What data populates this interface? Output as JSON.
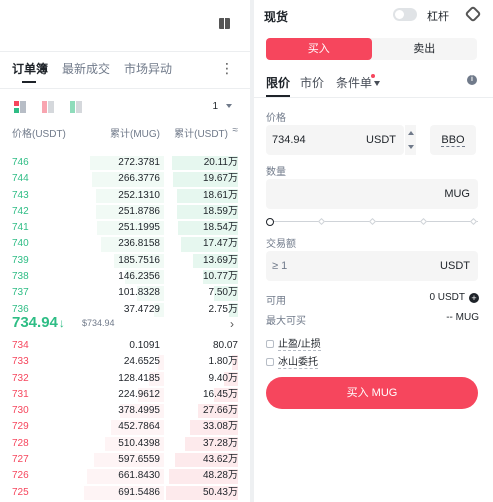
{
  "orderbook": {
    "tabs": [
      "订单簿",
      "最新成交",
      "市场异动"
    ],
    "more_icon": "more-vertical-icon",
    "depth_precision": "1",
    "headers": {
      "price": "价格(USDT)",
      "amount": "累计(MUG)",
      "total": "累计(USDT)",
      "toggle_icon": "≈"
    },
    "bids": [
      {
        "price": "746",
        "qty": "272.3781",
        "cum": "20.11万",
        "depth": 0.92
      },
      {
        "price": "744",
        "qty": "266.3776",
        "cum": "19.67万",
        "depth": 0.9
      },
      {
        "price": "743",
        "qty": "252.1310",
        "cum": "18.61万",
        "depth": 0.85
      },
      {
        "price": "742",
        "qty": "251.8786",
        "cum": "18.59万",
        "depth": 0.85
      },
      {
        "price": "741",
        "qty": "251.1995",
        "cum": "18.54万",
        "depth": 0.84
      },
      {
        "price": "740",
        "qty": "236.8158",
        "cum": "17.47万",
        "depth": 0.79
      },
      {
        "price": "739",
        "qty": "185.7516",
        "cum": "13.69万",
        "depth": 0.62
      },
      {
        "price": "738",
        "qty": "146.2356",
        "cum": "10.77万",
        "depth": 0.49
      },
      {
        "price": "737",
        "qty": "101.8328",
        "cum": "7.50万",
        "depth": 0.34
      },
      {
        "price": "736",
        "qty": "37.4729",
        "cum": "2.75万",
        "depth": 0.13
      }
    ],
    "last_price": "734.94",
    "last_price_arrow": "↓",
    "ref_price": "$734.94",
    "asks": [
      {
        "price": "734",
        "qty": "0.1091",
        "cum": "80.07",
        "depth": 0.0
      },
      {
        "price": "733",
        "qty": "24.6525",
        "cum": "1.80万",
        "depth": 0.08
      },
      {
        "price": "732",
        "qty": "128.4185",
        "cum": "9.40万",
        "depth": 0.19
      },
      {
        "price": "731",
        "qty": "224.9612",
        "cum": "16.45万",
        "depth": 0.33
      },
      {
        "price": "730",
        "qty": "378.4995",
        "cum": "27.66万",
        "depth": 0.55
      },
      {
        "price": "729",
        "qty": "452.7864",
        "cum": "33.08万",
        "depth": 0.66
      },
      {
        "price": "728",
        "qty": "510.4398",
        "cum": "37.28万",
        "depth": 0.74
      },
      {
        "price": "727",
        "qty": "597.6559",
        "cum": "43.62万",
        "depth": 0.87
      },
      {
        "price": "726",
        "qty": "661.8430",
        "cum": "48.28万",
        "depth": 0.96
      },
      {
        "price": "725",
        "qty": "691.5486",
        "cum": "50.43万",
        "depth": 1.0
      }
    ]
  },
  "trade": {
    "mode": "现货",
    "leverage_label": "杠杆",
    "leverage_on": false,
    "buy_tab": "买入",
    "sell_tab": "卖出",
    "order_types": [
      "限价",
      "市价",
      "条件单"
    ],
    "price_label": "价格",
    "price_value": "734.94",
    "price_unit": "USDT",
    "bbo": "BBO",
    "qty_label": "数量",
    "qty_unit": "MUG",
    "amount_label": "交易额",
    "amount_placeholder": "≥ 1",
    "amount_unit": "USDT",
    "available_label": "可用",
    "available_value": "0 USDT",
    "max_buy_label": "最大可买",
    "max_buy_value": "-- MUG",
    "tp_sl_label": "止盈/止损",
    "iceberg_label": "冰山委托",
    "submit_label": "买入 MUG"
  },
  "colors": {
    "buy": "#2ebd85",
    "sell": "#f6465d"
  }
}
